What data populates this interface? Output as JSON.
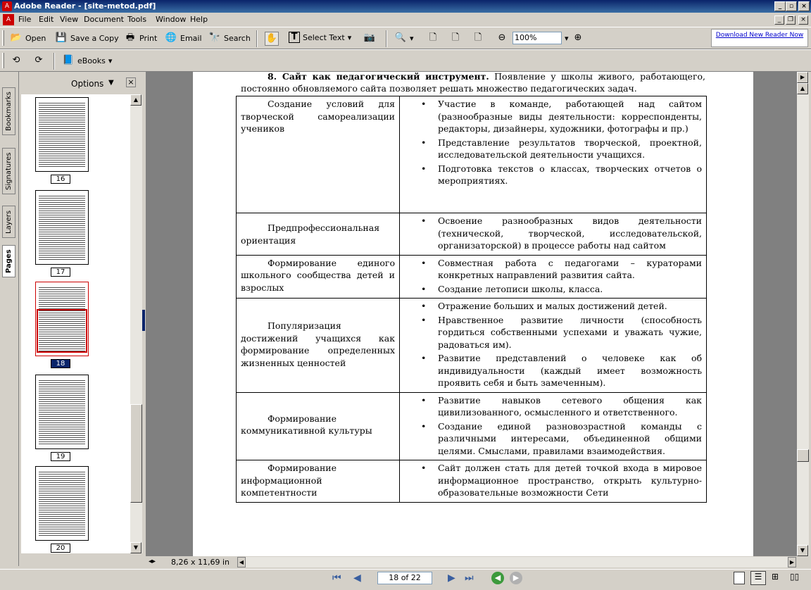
{
  "window": {
    "title": "Adobe Reader - [site-metod.pdf]"
  },
  "menu": [
    "File",
    "Edit",
    "View",
    "Document",
    "Tools",
    "Window",
    "Help"
  ],
  "toolbar": {
    "open": "Open",
    "save_copy": "Save a Copy",
    "print": "Print",
    "email": "Email",
    "search": "Search",
    "select_text": "Select Text",
    "zoom": "100%",
    "ebooks": "eBooks"
  },
  "ad": {
    "text": "Download New Reader Now"
  },
  "left_tabs": [
    "Bookmarks",
    "Signatures",
    "Layers",
    "Pages"
  ],
  "pages_panel": {
    "options": "Options",
    "thumbnails": [
      "16",
      "17",
      "18",
      "19",
      "20"
    ],
    "selected": "18"
  },
  "document": {
    "heading_bold": "8. Сайт как педагогический инструмент.",
    "heading_text": " Появление у школы живого, работающего, постоянно обновляемого сайта позволяет решать множество педагогических задач.",
    "rows": [
      {
        "left": "Создание условий для творческой самореализации учеников",
        "items": [
          "Участие в команде, работающей над сайтом (разнообразные виды деятельности: корреспонденты, редакторы, дизайнеры, художники, фотографы и пр.)",
          "Представление результатов творческой, проектной, исследовательской деятельности учащихся.",
          "Подготовка текстов о классах, творческих отчетов о мероприятиях."
        ]
      },
      {
        "left": "Предпрофессиональная ориентация",
        "items": [
          "Освоение разнообразных видов деятельности (технической, творческой, исследовательской, организаторской) в процессе работы над сайтом"
        ]
      },
      {
        "left": "Формирование единого школьного сообщества детей и взрослых",
        "items": [
          "Совместная работа с педагогами – кураторами конкретных направлений развития сайта.",
          "Создание летописи школы, класса."
        ]
      },
      {
        "left": "Популяризация достижений учащихся как формирование определенных жизненных ценностей",
        "items": [
          "Отражение больших и малых достижений детей.",
          "Нравственное развитие личности (способность гордиться собственными успехами и уважать чужие, радоваться им).",
          "Развитие представлений о человеке как об индивидуальности (каждый имеет возможность проявить себя и быть замеченным)."
        ]
      },
      {
        "left": "Формирование коммуникативной культуры",
        "items": [
          "Развитие навыков сетевого общения как цивилизованного, осмысленного и ответственного.",
          "Создание единой разновозрастной команды с различными интересами, объединенной общими целями. Смыслами, правилами взаимодействия."
        ]
      },
      {
        "left": "Формирование информационной компетентности",
        "items": [
          "Сайт должен стать для детей точкой входа в мировое информационное пространство, открыть культурно-образовательные возможности Сети"
        ]
      }
    ]
  },
  "status": {
    "page_size": "8,26 x 11,69 in",
    "page_indicator": "18 of 22"
  }
}
